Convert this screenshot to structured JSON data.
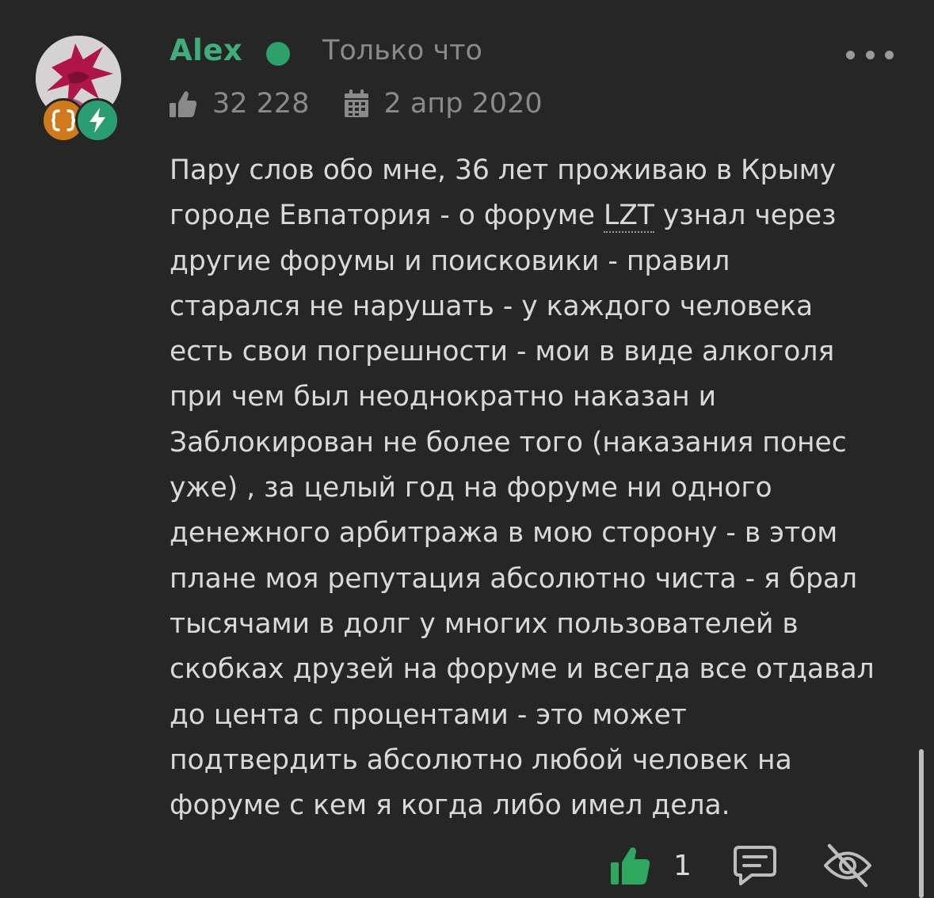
{
  "post": {
    "author": {
      "name": "Alex",
      "status": "online",
      "badges": [
        "code-badge",
        "lightning-badge"
      ]
    },
    "time": "Только что",
    "stats": {
      "likes": "32 228",
      "registered": "2 апр 2020"
    },
    "message": {
      "lines": [
        "Пару слов обо мне, 36 лет проживаю в Крыму",
        "городе Евпатория - о форуме ",
        "LZT",
        " узнал через",
        "другие форумы и поисковики - правил",
        "старался не нарушать - у каждого человека",
        "есть свои погрешности - мои в виде алкоголя",
        "при чем был неоднократно наказан и",
        "Заблокирован не более того (наказания понес",
        "уже) , за целый год на форуме ни одного",
        "денежного арбитража в мою сторону - в этом",
        "плане моя репутация абсолютно чиста - я брал",
        "тысячами в долг у многих пользователей в",
        "скобках друзей на форуме и всегда все отдавал",
        "до цента с процентами - это может",
        "подтвердить абсолютно любой человек на",
        "форуме с кем я когда либо имел дела."
      ]
    },
    "footer": {
      "like_count": "1"
    }
  },
  "colors": {
    "background": "#262626",
    "username": "#3fae7a",
    "online": "#2ea06a",
    "muted": "#8a8a8a",
    "text": "#d9d9d9",
    "like_icon": "#2fa85f",
    "badge_code": "#d07a1e",
    "badge_bolt": "#2a9d73"
  },
  "icons": [
    "more-dots-icon",
    "thumbs-up-icon",
    "calendar-icon",
    "reply-icon",
    "hide-eye-icon",
    "code-braces-icon",
    "lightning-icon"
  ]
}
